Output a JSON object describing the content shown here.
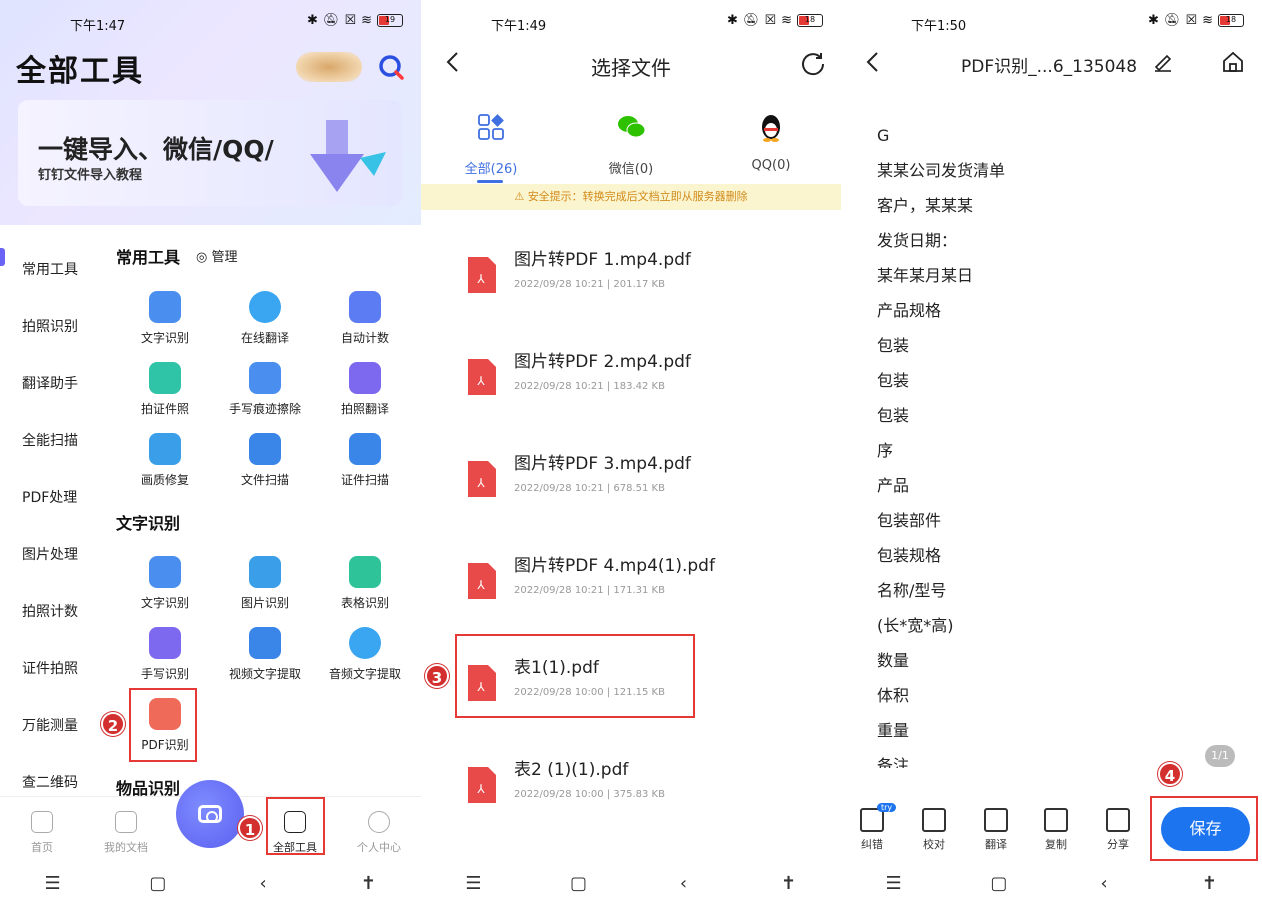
{
  "panel1": {
    "status": {
      "time": "下午1:47",
      "battery": "19"
    },
    "title": "全部工具",
    "banner": {
      "line1": "一键导入、微信/QQ/",
      "line2": "钉钉文件导入教程"
    },
    "sidebar": [
      "常用工具",
      "拍照识别",
      "翻译助手",
      "全能扫描",
      "PDF处理",
      "图片处理",
      "拍照计数",
      "证件拍照",
      "万能测量",
      "查二维码"
    ],
    "section_common": "常用工具",
    "manage_label": "管理",
    "common_tools": [
      "文字识别",
      "在线翻译",
      "自动计数",
      "拍证件照",
      "手写痕迹擦除",
      "拍照翻译",
      "画质修复",
      "文件扫描",
      "证件扫描"
    ],
    "section_ocr": "文字识别",
    "ocr_tools": [
      "文字识别",
      "图片识别",
      "表格识别",
      "手写识别",
      "视频文字提取",
      "音频文字提取",
      "PDF识别"
    ],
    "section_items": "物品识别",
    "bottom_tabs": [
      "首页",
      "我的文档",
      "全部工具",
      "个人中心"
    ],
    "badges": [
      "1",
      "2"
    ]
  },
  "panel2": {
    "status": {
      "time": "下午1:49",
      "battery": "18"
    },
    "title": "选择文件",
    "tabs": [
      "全部(26)",
      "微信(0)",
      "QQ(0)"
    ],
    "warning": "安全提示：转换完成后文档立即从服务器删除",
    "files": [
      {
        "name": "图片转PDF 1.mp4.pdf",
        "meta": "2022/09/28 10:21 |  201.17 KB"
      },
      {
        "name": "图片转PDF 2.mp4.pdf",
        "meta": "2022/09/28 10:21 |  183.42 KB"
      },
      {
        "name": "图片转PDF 3.mp4.pdf",
        "meta": "2022/09/28 10:21 |  678.51 KB"
      },
      {
        "name": "图片转PDF 4.mp4(1).pdf",
        "meta": "2022/09/28 10:21 |  171.31 KB"
      },
      {
        "name": "表1(1).pdf",
        "meta": "2022/09/28 10:00 |  121.15 KB"
      },
      {
        "name": "表2 (1)(1).pdf",
        "meta": "2022/09/28 10:00 |  375.83 KB"
      }
    ],
    "badge": "3"
  },
  "panel3": {
    "status": {
      "time": "下午1:50",
      "battery": "18"
    },
    "title": "PDF识别_...6_135048",
    "lines": [
      "G",
      "某某公司发货清单",
      "客户，某某某",
      "发货日期：",
      "某年某月某日",
      "产品规格",
      "包装",
      "包装",
      "包装",
      "序",
      "产品",
      "包装部件",
      "包装规格",
      "名称/型号",
      "(长*宽*高)",
      "数量",
      "体积",
      "重量",
      "备注"
    ],
    "page_indicator": "1/1",
    "tools": [
      "纠错",
      "校对",
      "翻译",
      "复制",
      "分享"
    ],
    "try_label": "try",
    "save_label": "保存",
    "badge": "4"
  },
  "colors": {
    "accent": "#1d74ef",
    "highlight": "#e53935",
    "brand_purple": "#6a63f6",
    "pdf_red": "#e84a4a"
  }
}
